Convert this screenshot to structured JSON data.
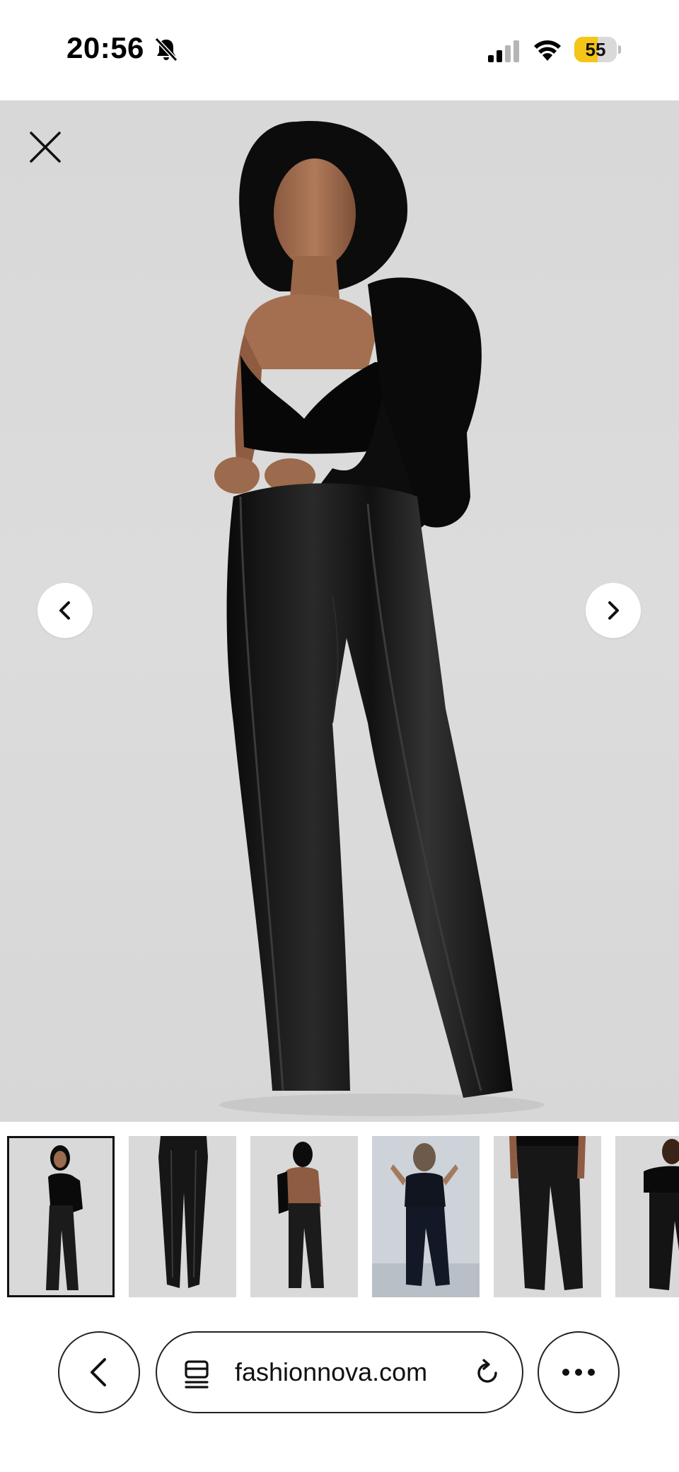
{
  "status_bar": {
    "time": "20:56",
    "silent_icon": "bell-slash-icon",
    "signal_icon": "cellular-signal-icon",
    "wifi_icon": "wifi-icon",
    "battery_level": "55",
    "battery_fraction": 0.55,
    "battery_color": "#f5c518"
  },
  "viewer": {
    "close_icon": "close-x-icon",
    "prev_icon": "chevron-left-icon",
    "next_icon": "chevron-right-icon",
    "background_color": "#d9d9d9"
  },
  "thumbnails": {
    "count_visible": 6,
    "selected_index": 0
  },
  "toolbar": {
    "back_icon": "chevron-left-icon",
    "tabs_icon": "tabs-icon",
    "address": "fashionnova.com",
    "reload_icon": "reload-icon",
    "more_icon": "ellipsis-icon"
  }
}
